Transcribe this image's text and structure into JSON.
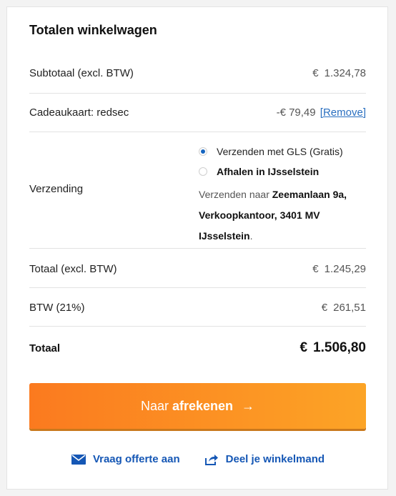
{
  "cart_totals": {
    "title": "Totalen winkelwagen",
    "subtotal": {
      "label": "Subtotaal (excl. BTW)",
      "currency": "€",
      "amount": "1.324,78"
    },
    "giftcard": {
      "label": "Cadeaukaart: redsec",
      "value": "-€ 79,49",
      "remove_label": "[Remove]"
    },
    "shipping": {
      "label": "Verzending",
      "options": [
        {
          "label": "Verzenden met GLS (Gratis)",
          "selected": true
        },
        {
          "label": "Afhalen in IJsselstein",
          "selected": false
        }
      ],
      "address_prefix": "Verzenden naar",
      "address_bold": "Zeemanlaan 9a, Verkoopkantoor, 3401 MV IJsselstein",
      "address_suffix": "."
    },
    "total_excl": {
      "label": "Totaal (excl. BTW)",
      "currency": "€",
      "amount": "1.245,29"
    },
    "vat": {
      "label": "BTW (21%)",
      "currency": "€",
      "amount": "261,51"
    },
    "total": {
      "label": "Totaal",
      "currency": "€",
      "amount": "1.506,80"
    }
  },
  "checkout_button": {
    "label_regular": "Naar",
    "label_bold": "afrekenen",
    "arrow": "→"
  },
  "links": {
    "quote": {
      "label": "Vraag offerte aan",
      "icon": "envelope-icon"
    },
    "share": {
      "label": "Deel je winkelmand",
      "icon": "share-icon"
    }
  },
  "colors": {
    "accent_orange_start": "#fb7a1f",
    "accent_orange_end": "#fca426",
    "link_blue": "#1557b5",
    "radio_blue": "#1565c0"
  }
}
